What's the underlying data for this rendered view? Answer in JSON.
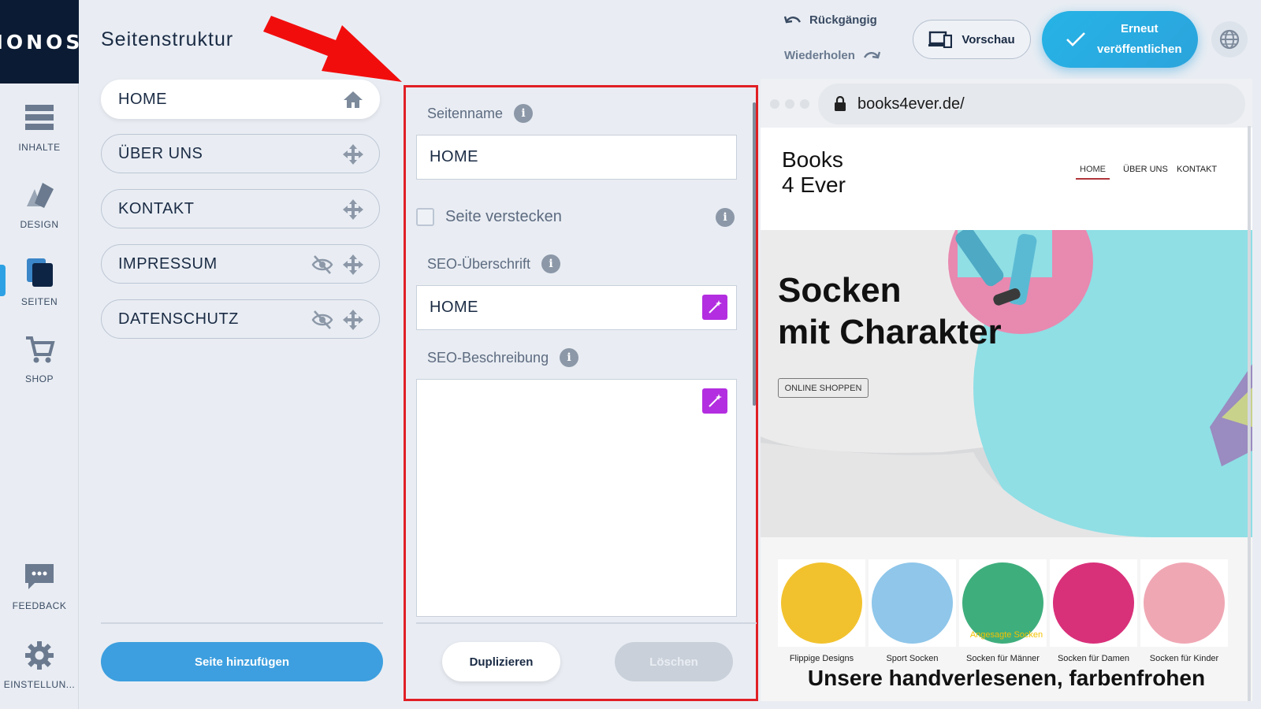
{
  "brand": {
    "logo": "IONOS"
  },
  "rail": {
    "items": [
      {
        "label": "INHALTE",
        "icon": "content-icon"
      },
      {
        "label": "DESIGN",
        "icon": "design-icon"
      },
      {
        "label": "SEITEN",
        "icon": "pages-icon",
        "active": true
      },
      {
        "label": "SHOP",
        "icon": "cart-icon"
      },
      {
        "label": "FEEDBACK",
        "icon": "feedback-icon"
      },
      {
        "label": "EINSTELLUN...",
        "icon": "gear-icon"
      }
    ]
  },
  "header": {
    "title": "Seitenstruktur",
    "undo_label": "Rückgängig",
    "redo_label": "Wiederholen",
    "preview_label": "Vorschau",
    "publish_line1": "Erneut",
    "publish_line2": "veröffentlichen"
  },
  "pages": {
    "items": [
      {
        "label": "HOME",
        "active": true,
        "icon": "home-icon"
      },
      {
        "label": "ÜBER UNS",
        "icon": "move-icon"
      },
      {
        "label": "KONTAKT",
        "icon": "move-icon"
      },
      {
        "label": "IMPRESSUM",
        "icon": "move-icon",
        "hidden": true
      },
      {
        "label": "DATENSCHUTZ",
        "icon": "move-icon",
        "hidden": true
      }
    ],
    "add_label": "Seite hinzufügen"
  },
  "settings": {
    "pagename_label": "Seitenname",
    "pagename_value": "HOME",
    "hide_label": "Seite verstecken",
    "hide_checked": false,
    "seo_title_label": "SEO-Überschrift",
    "seo_title_value": "HOME",
    "seo_desc_label": "SEO-Beschreibung",
    "seo_desc_value": "",
    "duplicate_label": "Duplizieren",
    "delete_label": "Löschen",
    "info_glyph": "i"
  },
  "preview": {
    "url": "books4ever.de/",
    "brand_line1": "Books",
    "brand_line2": "4 Ever",
    "nav": [
      "HOME",
      "ÜBER UNS",
      "KONTAKT"
    ],
    "hero_line1": "Socken",
    "hero_line2": "mit Charakter",
    "hero_button": "ONLINE SHOPPEN",
    "categories": [
      {
        "name": "Flippige Designs",
        "color": "#f2c22e"
      },
      {
        "name": "Sport Socken",
        "color": "#8fc6ea"
      },
      {
        "name": "Socken für Männer",
        "color": "#3fae7d"
      },
      {
        "name": "Socken für Damen",
        "color": "#d9307a"
      },
      {
        "name": "Socken für Kinder",
        "color": "#f0a7b4"
      }
    ],
    "eyebrow": "Angesagte Socken",
    "section_title": "Unsere handverlesenen, farbenfrohen"
  },
  "colors": {
    "accent": "#2ea1e4",
    "highlight": "#e01f25",
    "wand": "#b32ee0"
  }
}
